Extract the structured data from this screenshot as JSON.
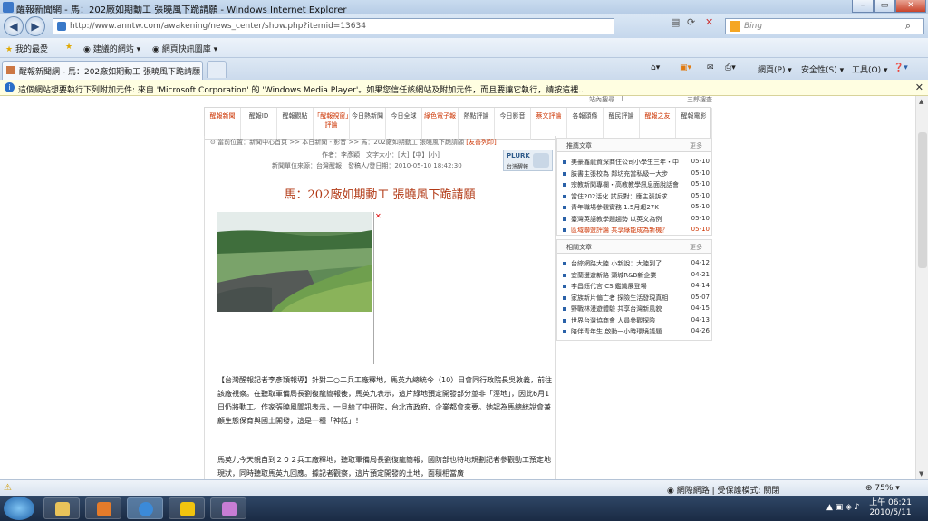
{
  "window": {
    "title": "醒報新聞網 - 馬：202廠如期動工 張曉風下跪請願 - Windows Internet Explorer"
  },
  "toolbar": {
    "url": "http://www.anntw.com/awakening/news_center/show.php?itemid=13634",
    "search_placeholder": "Bing"
  },
  "favorites": {
    "label": "我的最愛",
    "items": [
      "建議的網站 ▾",
      "網頁快訊圖庫 ▾"
    ]
  },
  "tab": {
    "title": "醒報新聞網 - 馬：202廠如期動工 張曉風下跪請願"
  },
  "commands": {
    "page": "網頁(P) ▾",
    "safety": "安全性(S) ▾",
    "tools": "工具(O) ▾"
  },
  "infobar": {
    "message": "這個網站想要執行下列附加元件: 來自 'Microsoft Corporation' 的 'Windows Media Player'。如果您信任該網站及附加元件，而且要讓它執行，請按這裡..."
  },
  "site": {
    "search_label": "站內搜尋",
    "search_go": "三郎搜查",
    "nav": [
      "醒報新聞",
      "醒報ID",
      "醒報觀點",
      "「醒報視窗」評論",
      "今日熱新聞",
      "今日全球",
      "綠色電子報",
      "熱點評論",
      "今日影音",
      "蔡文評論",
      "各報頭條",
      "醒民評論",
      "醒報之友",
      "醒報電影"
    ],
    "breadcrumb": "當前位置：新聞中心首頁 >> 本日新聞 - 影音 >> 馬：202廠如期動工 張曉風下跪請願",
    "breadcrumb_tag": "[友善列印]",
    "author": "作者：李彥穎　文字大小：[大]【中】[小]",
    "meta": "新聞單位來源：台灣醒報　發稿人/發日期：2010-05-10 18:42:30",
    "plurk": {
      "title": "PLURK",
      "sub": "台灣醒報"
    },
    "headline": "馬：202廠如期動工 張曉風下跪請願",
    "paragraph1": "【台灣醒報記者李彥穎報導】針對二○二兵工廠釋地，馬英九總統今（10）日會同行政院長吳敦義，前往該廠視察。在聽取軍備局長劉復龍簡報後，馬英九表示，這片綠地預定開發部分並非「溼地」，因此6月1日仍將動工。作家張曉風聞訊表示，一旦給了中研院，台北市政府、企業都會來要。她認為馬總統說會兼顧生態保育與國土開發，這是一種「神話」！",
    "paragraph2": "馬英九今天親自到２０２兵工廠釋地，聽取軍備局長劉復龍簡報，國防部也特地規劃記者參觀動工預定地現狀，同時聽取馬英九回應。據記者觀察，這片預定開發的土地，面積相當廣"
  },
  "sidebar": {
    "recommended": {
      "title": "推薦文章",
      "more": "更多",
      "items": [
        {
          "t": "美豪鑫龍資深商住公司小學生三年・中",
          "d": "05-10"
        },
        {
          "t": "臉書主張校為 鄰坊充當私級一大步",
          "d": "05-10"
        },
        {
          "t": "宗教新聞專欄・高教教學訊息面說話會",
          "d": "05-10"
        },
        {
          "t": "當住202活化 試反對：應主張訴求",
          "d": "05-10"
        },
        {
          "t": "青年職場參觀實務 1.5月超27K",
          "d": "05-10"
        },
        {
          "t": "臺灣英語教學題趨勢 以英文為例",
          "d": "05-10"
        },
        {
          "t": "區域聯盟評論 共享綠能成為新機？",
          "d": "05-10"
        }
      ]
    },
    "related": {
      "title": "相關文章",
      "more": "更多",
      "items": [
        {
          "t": "台綜網路大陸 小新說：大陸到了",
          "d": "04-12"
        },
        {
          "t": "宜蘭漫遊新路 頭城R&B新企業",
          "d": "04-21"
        },
        {
          "t": "李昌鈺代言 CSI鑑識展登場",
          "d": "04-14"
        },
        {
          "t": "家族新片偏亡者 探險生活發現真相",
          "d": "05-07"
        },
        {
          "t": "野戰林漫遊體驗 共享台灣新風貌",
          "d": "04-15"
        },
        {
          "t": "世界台灣協商會 人員參觀探險",
          "d": "04-13"
        },
        {
          "t": "陪伴青年生 啟動一小時環境議題",
          "d": "04-26"
        }
      ]
    }
  },
  "status": {
    "zone": "網際網路 | 受保護模式: 關閉",
    "zoom": "75%"
  },
  "taskbar": {
    "time": "上午 06:21",
    "date": "2010/5/11"
  },
  "colors": {
    "headline": "#b23a16",
    "nav_red": "#cc3300"
  }
}
